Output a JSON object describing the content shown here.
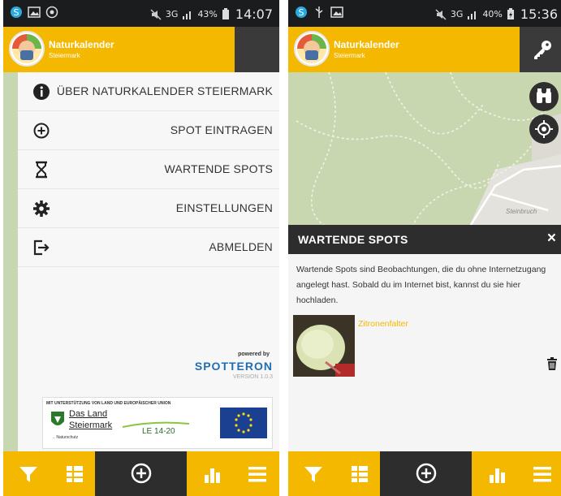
{
  "status_left": {
    "time": "14:07",
    "battery": "43%",
    "network": "3G"
  },
  "status_right": {
    "time": "15:36",
    "battery": "40%",
    "network": "3G"
  },
  "app": {
    "title": "Naturkalender",
    "subtitle": "Steiermark"
  },
  "menu": {
    "items": [
      {
        "label": "ÜBER NATURKALENDER STEIERMARK",
        "icon": "info-icon"
      },
      {
        "label": "SPOT EINTRAGEN",
        "icon": "add-location-icon"
      },
      {
        "label": "WARTENDE SPOTS",
        "icon": "hourglass-icon"
      },
      {
        "label": "EINSTELLUNGEN",
        "icon": "gear-icon"
      },
      {
        "label": "ABMELDEN",
        "icon": "logout-icon"
      }
    ],
    "powered_by": "powered by",
    "brand": "SPOTTERON",
    "version": "VERSION 1.0.3"
  },
  "sponsor": {
    "heading": "MIT UNTERSTÜTZUNG VON LAND UND EUROPÄISCHER UNION",
    "land_line1": "Das Land",
    "land_line2": "Steiermark",
    "naturschutz": "→ Naturschutz",
    "le": "LE 14-20"
  },
  "map": {
    "label": "Steinbruch"
  },
  "dialog": {
    "title": "WARTENDE SPOTS",
    "close": "×",
    "text": "Wartende Spots sind Beobachtungen, die du ohne Internetzugang angelegt hast. Sobald du im Internet bist, kannst du sie hier hochladen.",
    "spot_name": "Zitronenfalter"
  },
  "colors": {
    "accent": "#f5b800",
    "dark": "#2d2d2d",
    "brand_blue": "#1f6eb3"
  }
}
